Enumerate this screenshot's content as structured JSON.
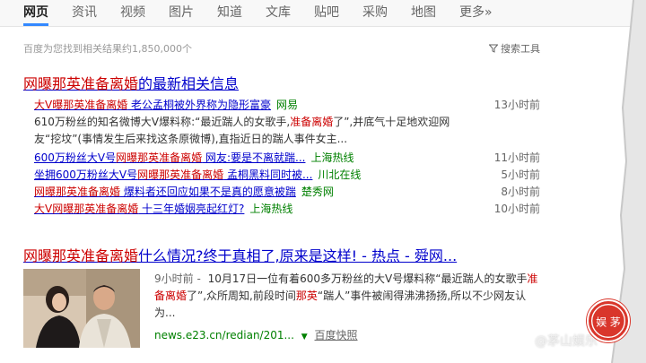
{
  "tabs": [
    {
      "label": "网页",
      "active": true
    },
    {
      "label": "资讯"
    },
    {
      "label": "视频"
    },
    {
      "label": "图片"
    },
    {
      "label": "知道"
    },
    {
      "label": "文库"
    },
    {
      "label": "贴吧"
    },
    {
      "label": "采购"
    },
    {
      "label": "地图"
    },
    {
      "label": "更多»"
    }
  ],
  "result_count": "百度为您找到相关结果约1,850,000个",
  "search_tools": "搜索工具",
  "news": {
    "title_hl": "网曝那英准备离婚",
    "title_rest": "的最新相关信息",
    "items": [
      {
        "parts": [
          "大V曝那英准备离婚",
          " 老公孟桐被外界称为隐形富豪"
        ],
        "source": "网易",
        "time": "13小时前",
        "snippet": [
          "610万粉丝的知名微博大V爆料称:“最近踹人的女歌手,",
          "准备离婚",
          "了”,并底气十足地欢迎网友“挖坟”(事情发生后来找这条原微博),直指近日的踹人事件女主..."
        ]
      },
      {
        "parts": [
          "600万粉丝大V号",
          "网曝那英准备离婚",
          " 网友:要是不离就踹..."
        ],
        "source": "上海热线",
        "time": "11小时前"
      },
      {
        "parts": [
          "坐拥600万粉丝大V号",
          "网曝那英准备离婚",
          " 孟桐黑料同时被..."
        ],
        "source": "川北在线",
        "time": "5小时前"
      },
      {
        "parts": [
          "网曝那英准备离婚",
          " 爆料者还回应如果不是真的愿意被踹"
        ],
        "source": "楚秀网",
        "time": "8小时前"
      },
      {
        "parts": [
          "大V网曝那英准备离婚",
          " 十三年婚姻亮起红灯?"
        ],
        "source": "上海热线",
        "time": "10小时前"
      }
    ]
  },
  "main_result": {
    "title_hl": "网曝那英准备离婚",
    "title_rest": "什么情况?终于真相了,原来是这样! - 热点 - 舜网...",
    "date": "9小时前 -",
    "body_1": " 10月17日一位有着600多万粉丝的大V号爆料称“最近踹人的女歌手",
    "body_hl1": "准备离婚",
    "body_2": "了”,众所周知,前段时间",
    "body_hl2": "那英",
    "body_3": "“踹人”事件被闹得沸沸扬扬,所以不少网友认为...",
    "url": "news.e23.cn/redian/201...",
    "snapshot": "百度快照"
  },
  "watermark": "@茅山娱乐",
  "seal_text": "娱 茅",
  "colors": {
    "link": "#0000cc",
    "highlight": "#cc0000",
    "source": "#008000",
    "seal": "#d9362b"
  }
}
